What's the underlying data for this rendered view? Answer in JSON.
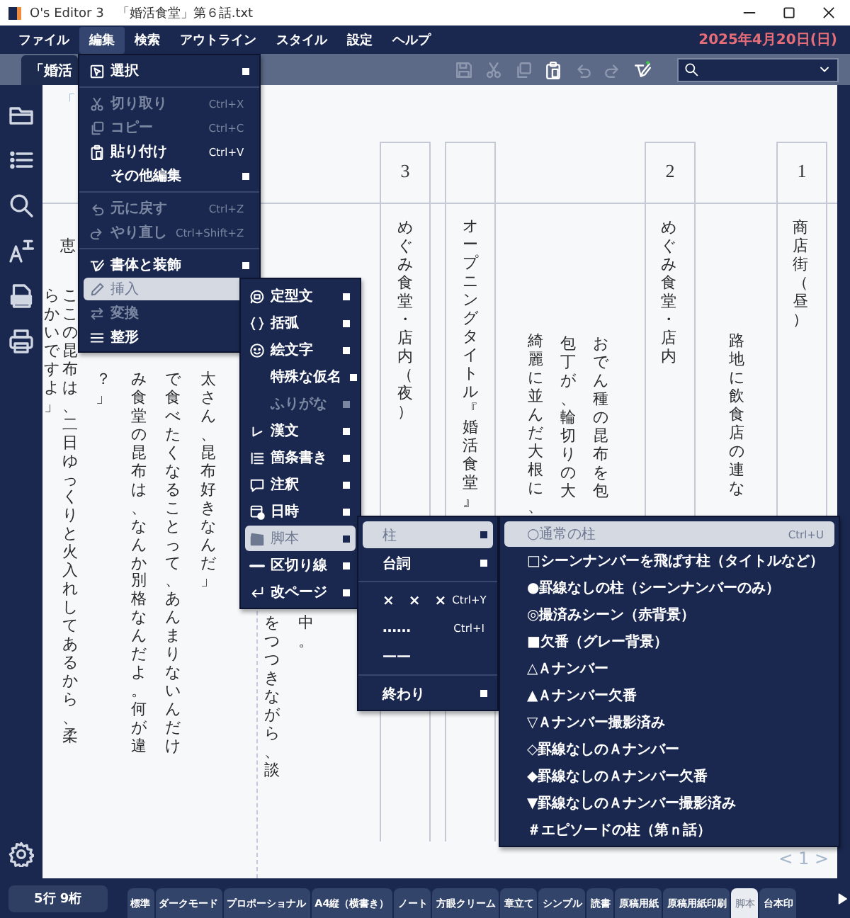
{
  "window": {
    "title": "O's Editor 3　「婚活食堂」第６話.txt"
  },
  "menu_bar": {
    "items": [
      {
        "label": "ファイル",
        "selected": false
      },
      {
        "label": "編集",
        "selected": true
      },
      {
        "label": "検索",
        "selected": false
      },
      {
        "label": "アウトライン",
        "selected": false
      },
      {
        "label": "スタイル",
        "selected": false
      },
      {
        "label": "設定",
        "selected": false
      },
      {
        "label": "ヘルプ",
        "selected": false
      }
    ],
    "date": "2025年4月20日(日)"
  },
  "document_tab": {
    "label": "「婚活"
  },
  "toolbar": {
    "buttons": [
      {
        "disabled": true
      },
      {
        "disabled": true
      },
      {
        "disabled": true
      },
      {
        "disabled": false
      },
      {
        "disabled": true
      },
      {
        "disabled": true
      },
      {
        "disabled": false
      }
    ]
  },
  "document": {
    "scene_numbers": [
      "3",
      "2",
      "1"
    ],
    "lines": [
      "「",
      "らかいですよ」",
      "恵",
      "ここの昆布は、二日ゆっくりと火入れしてあるから、柔",
      "？」",
      "み食堂の昆布は、なんか別格なんだよ。何が違",
      "で食べたくなることって、あんまりないんだけ",
      "太さん、昆布好きなんだ」",
      "をつつきながら、談",
      "中。",
      "めぐみ食堂・店内（夜）",
      "オープニングタイトル『婚活食堂』",
      "綺麗に並んだ大根に、",
      "包丁が、輪切りの大",
      "おでん種の昆布を包",
      "めぐみ食堂・店内",
      "路地に飲食店の連な",
      "商店街（昼）"
    ],
    "page_number": "< 1 >"
  },
  "menus": [
    {
      "items": [
        {
          "kind": "item",
          "label": "選択",
          "submenu": true,
          "disabled": false,
          "selected": false
        },
        {
          "kind": "separator"
        },
        {
          "kind": "item",
          "label": "切り取り",
          "shortcut": "Ctrl+X",
          "submenu": false,
          "disabled": true,
          "selected": false
        },
        {
          "kind": "item",
          "label": "コピー",
          "shortcut": "Ctrl+C",
          "submenu": false,
          "disabled": true,
          "selected": false
        },
        {
          "kind": "item",
          "label": "貼り付け",
          "shortcut": "Ctrl+V",
          "submenu": false,
          "disabled": false,
          "selected": false
        },
        {
          "kind": "item",
          "label": "その他編集",
          "submenu": true,
          "disabled": false,
          "selected": false
        },
        {
          "kind": "separator"
        },
        {
          "kind": "item",
          "label": "元に戻す",
          "shortcut": "Ctrl+Z",
          "submenu": false,
          "disabled": true,
          "selected": false
        },
        {
          "kind": "item",
          "label": "やり直し",
          "shortcut": "Ctrl+Shift+Z",
          "submenu": false,
          "disabled": true,
          "selected": false
        },
        {
          "kind": "separator"
        },
        {
          "kind": "item",
          "label": "書体と装飾",
          "submenu": true,
          "disabled": false,
          "selected": false
        },
        {
          "kind": "item",
          "label": "挿入",
          "submenu": true,
          "disabled": false,
          "selected": true
        },
        {
          "kind": "item",
          "label": "変換",
          "submenu": true,
          "disabled": true,
          "selected": false
        },
        {
          "kind": "item",
          "label": "整形",
          "submenu": true,
          "disabled": false,
          "selected": false
        }
      ]
    },
    {
      "items": [
        {
          "kind": "item",
          "label": "定型文",
          "submenu": true,
          "disabled": false,
          "selected": false
        },
        {
          "kind": "item",
          "label": "括弧",
          "submenu": true,
          "disabled": false,
          "selected": false
        },
        {
          "kind": "item",
          "label": "絵文字",
          "submenu": true,
          "disabled": false,
          "selected": false
        },
        {
          "kind": "item",
          "label": "特殊な仮名",
          "submenu": true,
          "disabled": false,
          "selected": false
        },
        {
          "kind": "item",
          "label": "ふりがな",
          "submenu": true,
          "disabled": true,
          "selected": false
        },
        {
          "kind": "item",
          "label": "漢文",
          "submenu": true,
          "disabled": false,
          "selected": false
        },
        {
          "kind": "item",
          "label": "箇条書き",
          "submenu": true,
          "disabled": false,
          "selected": false
        },
        {
          "kind": "item",
          "label": "注釈",
          "submenu": true,
          "disabled": false,
          "selected": false
        },
        {
          "kind": "item",
          "label": "日時",
          "submenu": true,
          "disabled": false,
          "selected": false
        },
        {
          "kind": "item",
          "label": "脚本",
          "submenu": true,
          "disabled": false,
          "selected": true
        },
        {
          "kind": "item",
          "label": "区切り線",
          "submenu": true,
          "disabled": false,
          "selected": false
        },
        {
          "kind": "item",
          "label": "改ページ",
          "submenu": true,
          "disabled": false,
          "selected": false
        }
      ]
    },
    {
      "items": [
        {
          "kind": "item",
          "label": "柱",
          "submenu": true,
          "disabled": false,
          "selected": true
        },
        {
          "kind": "item",
          "label": "台詞",
          "submenu": true,
          "disabled": false,
          "selected": false
        },
        {
          "kind": "separator"
        },
        {
          "kind": "item",
          "label": "×　×　×",
          "shortcut": "Ctrl+Y",
          "submenu": false,
          "disabled": false,
          "selected": false
        },
        {
          "kind": "item",
          "label": "……",
          "shortcut": "Ctrl+I",
          "submenu": false,
          "disabled": false,
          "selected": false
        },
        {
          "kind": "item",
          "label": "——",
          "submenu": false,
          "disabled": false,
          "selected": false
        },
        {
          "kind": "separator"
        },
        {
          "kind": "item",
          "label": "終わり",
          "submenu": true,
          "disabled": false,
          "selected": false
        }
      ]
    },
    {
      "items": [
        {
          "kind": "item",
          "label": "○通常の柱",
          "shortcut": "Ctrl+U",
          "submenu": false,
          "disabled": false,
          "selected": true
        },
        {
          "kind": "item",
          "label": "□シーンナンバーを飛ばす柱（タイトルなど）",
          "submenu": false,
          "disabled": false,
          "selected": false
        },
        {
          "kind": "item",
          "label": "●罫線なしの柱（シーンナンバーのみ）",
          "submenu": false,
          "disabled": false,
          "selected": false
        },
        {
          "kind": "item",
          "label": "◎撮済みシーン（赤背景）",
          "submenu": false,
          "disabled": false,
          "selected": false
        },
        {
          "kind": "item",
          "label": "■欠番（グレー背景）",
          "submenu": false,
          "disabled": false,
          "selected": false
        },
        {
          "kind": "item",
          "label": "△Ａナンバー",
          "submenu": false,
          "disabled": false,
          "selected": false
        },
        {
          "kind": "item",
          "label": "▲Ａナンバー欠番",
          "submenu": false,
          "disabled": false,
          "selected": false
        },
        {
          "kind": "item",
          "label": "▽Ａナンバー撮影済み",
          "submenu": false,
          "disabled": false,
          "selected": false
        },
        {
          "kind": "item",
          "label": "◇罫線なしのＡナンバー",
          "submenu": false,
          "disabled": false,
          "selected": false
        },
        {
          "kind": "item",
          "label": "◆罫線なしのＡナンバー欠番",
          "submenu": false,
          "disabled": false,
          "selected": false
        },
        {
          "kind": "item",
          "label": "▼罫線なしのＡナンバー撮影済み",
          "submenu": false,
          "disabled": false,
          "selected": false
        },
        {
          "kind": "item",
          "label": "＃エピソードの柱（第ｎ話）",
          "submenu": false,
          "disabled": false,
          "selected": false
        }
      ]
    }
  ],
  "status_bar": {
    "position": "5行 9桁",
    "style_tabs": [
      {
        "label": "標準",
        "selected": false
      },
      {
        "label": "ダークモード",
        "selected": false
      },
      {
        "label": "プロポーショナル",
        "selected": false
      },
      {
        "label": "A4縦（横書き）",
        "selected": false
      },
      {
        "label": "ノート",
        "selected": false
      },
      {
        "label": "方眼クリーム",
        "selected": false
      },
      {
        "label": "章立て",
        "selected": false
      },
      {
        "label": "シンプル",
        "selected": false
      },
      {
        "label": "読書",
        "selected": false
      },
      {
        "label": "原稿用紙",
        "selected": false
      },
      {
        "label": "原稿用紙印刷",
        "selected": false
      },
      {
        "label": "脚本",
        "selected": true
      },
      {
        "label": "台本印",
        "selected": false
      }
    ]
  }
}
